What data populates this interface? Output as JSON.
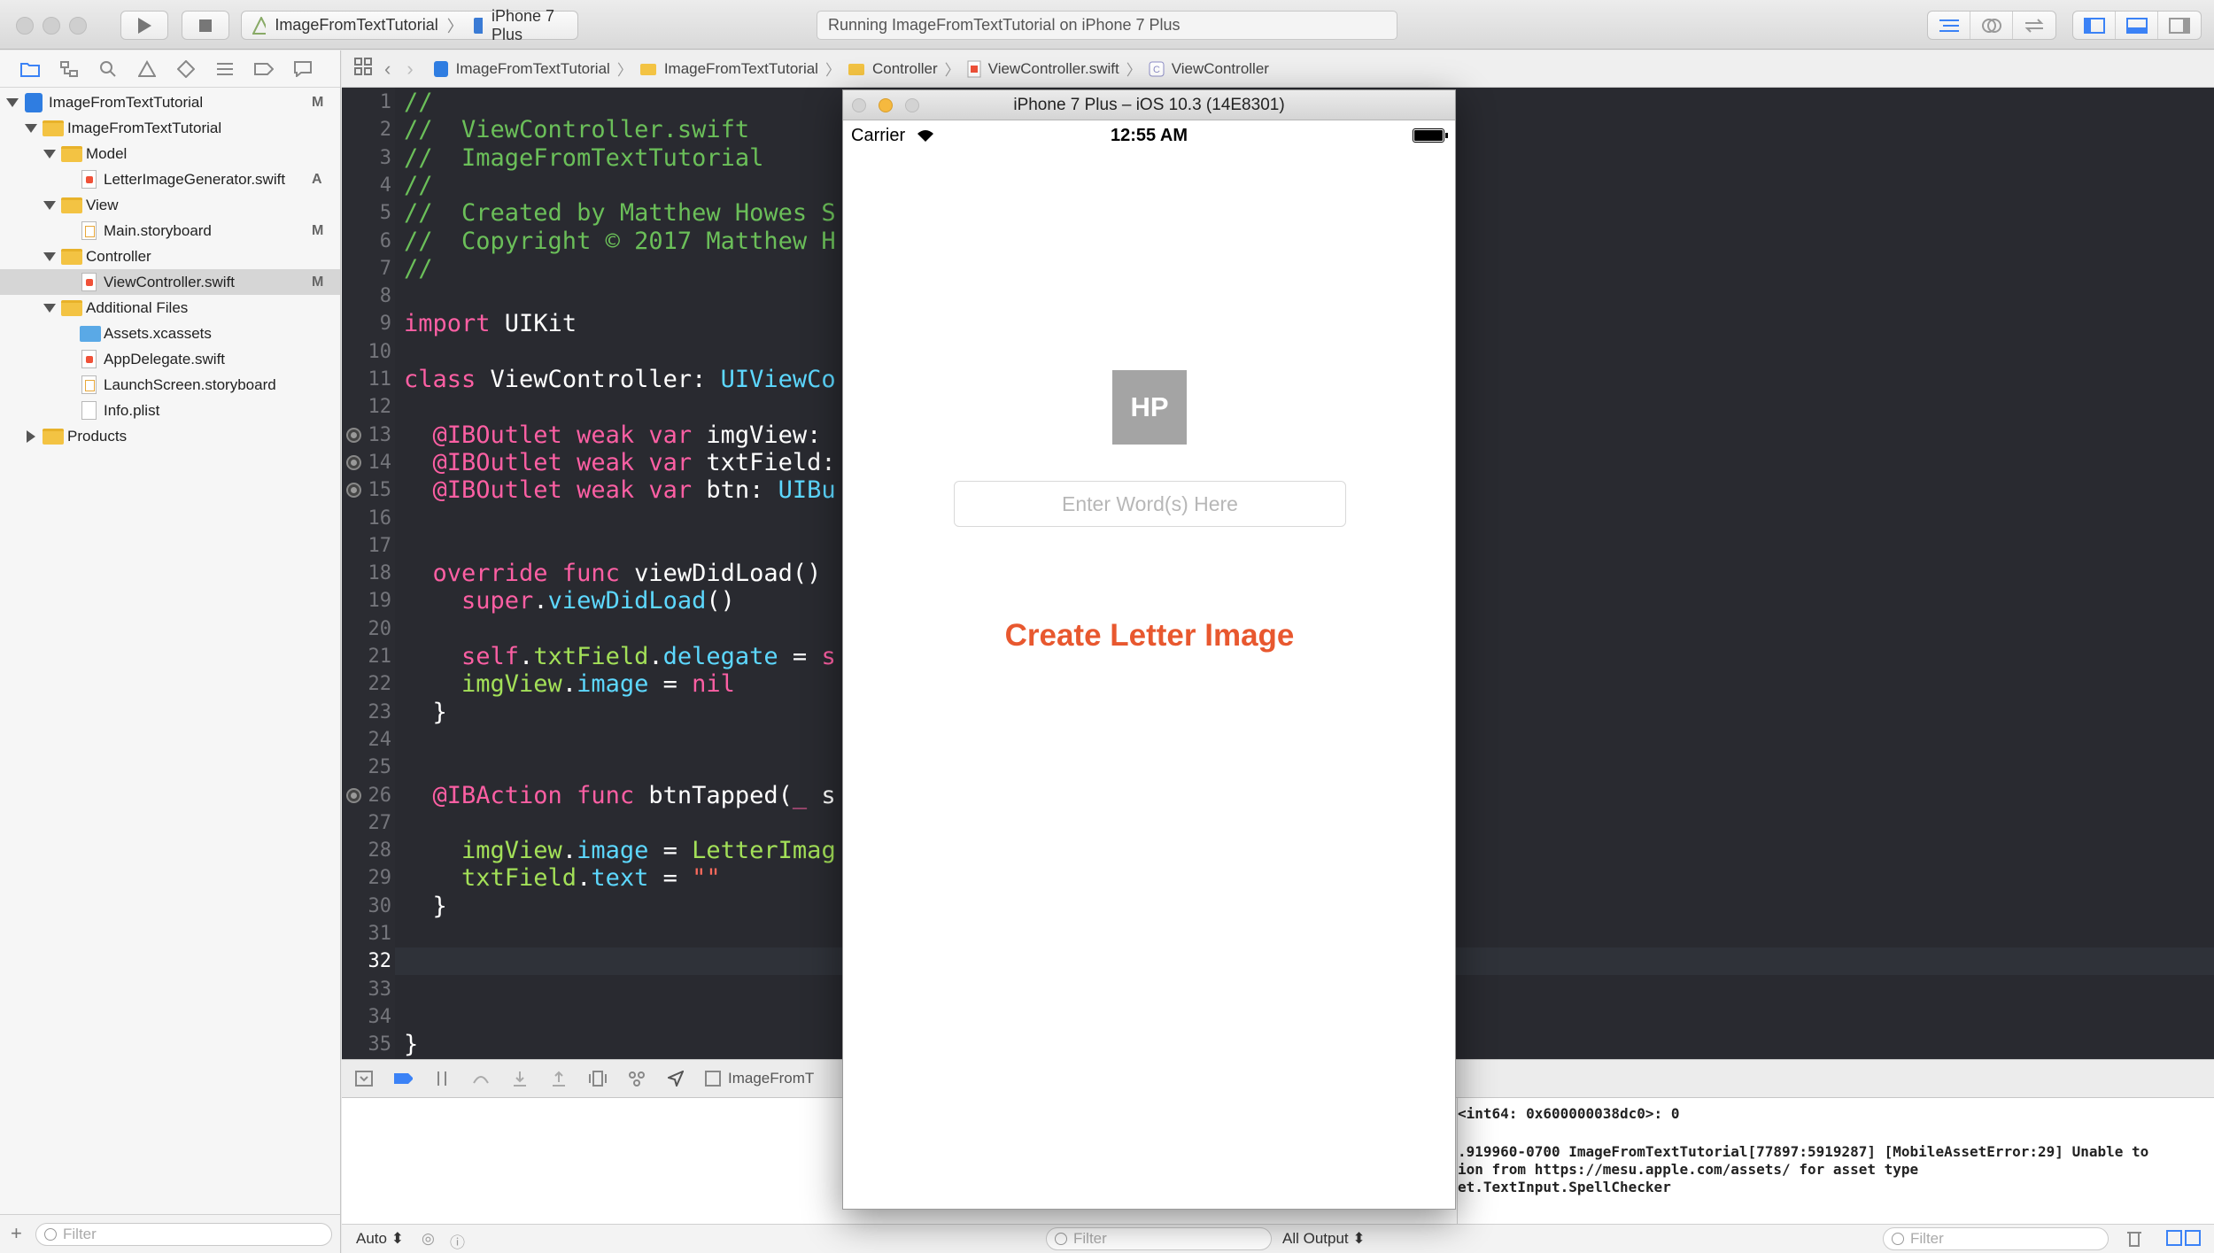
{
  "toolbar": {
    "scheme_project": "ImageFromTextTutorial",
    "scheme_device": "iPhone 7 Plus",
    "activity_status": "Running ImageFromTextTutorial on iPhone 7 Plus"
  },
  "navigator": {
    "tree": [
      {
        "label": "ImageFromTextTutorial",
        "badge": "M"
      },
      {
        "label": "ImageFromTextTutorial",
        "badge": ""
      },
      {
        "label": "Model",
        "badge": ""
      },
      {
        "label": "LetterImageGenerator.swift",
        "badge": "A"
      },
      {
        "label": "View",
        "badge": ""
      },
      {
        "label": "Main.storyboard",
        "badge": "M"
      },
      {
        "label": "Controller",
        "badge": ""
      },
      {
        "label": "ViewController.swift",
        "badge": "M"
      },
      {
        "label": "Additional Files",
        "badge": ""
      },
      {
        "label": "Assets.xcassets",
        "badge": ""
      },
      {
        "label": "AppDelegate.swift",
        "badge": ""
      },
      {
        "label": "LaunchScreen.storyboard",
        "badge": ""
      },
      {
        "label": "Info.plist",
        "badge": ""
      },
      {
        "label": "Products",
        "badge": ""
      }
    ],
    "filter_placeholder": "Filter"
  },
  "jumpbar": {
    "items": [
      "ImageFromTextTutorial",
      "ImageFromTextTutorial",
      "Controller",
      "ViewController.swift",
      "ViewController"
    ]
  },
  "editor": {
    "line_numbers": [
      "1",
      "2",
      "3",
      "4",
      "5",
      "6",
      "7",
      "8",
      "9",
      "10",
      "11",
      "12",
      "13",
      "14",
      "15",
      "16",
      "17",
      "18",
      "19",
      "20",
      "21",
      "22",
      "23",
      "24",
      "25",
      "26",
      "27",
      "28",
      "29",
      "30",
      "31",
      "32",
      "33",
      "34",
      "35"
    ],
    "current_line": "32",
    "lines": [
      {
        "n": 1,
        "parts": [
          {
            "c": "c-comment",
            "t": "//"
          }
        ]
      },
      {
        "n": 2,
        "parts": [
          {
            "c": "c-comment",
            "t": "//  ViewController.swift"
          }
        ]
      },
      {
        "n": 3,
        "parts": [
          {
            "c": "c-comment",
            "t": "//  ImageFromTextTutorial"
          }
        ]
      },
      {
        "n": 4,
        "parts": [
          {
            "c": "c-comment",
            "t": "//"
          }
        ]
      },
      {
        "n": 5,
        "parts": [
          {
            "c": "c-comment",
            "t": "//  Created by Matthew Howes S"
          }
        ]
      },
      {
        "n": 6,
        "parts": [
          {
            "c": "c-comment",
            "t": "//  Copyright © 2017 Matthew H"
          }
        ]
      },
      {
        "n": 7,
        "parts": [
          {
            "c": "c-comment",
            "t": "//"
          }
        ]
      },
      {
        "n": 9,
        "parts": [
          {
            "c": "c-kw",
            "t": "import"
          },
          {
            "c": "",
            "t": " UIKit"
          }
        ]
      },
      {
        "n": 11,
        "parts": [
          {
            "c": "c-kw",
            "t": "class"
          },
          {
            "c": "",
            "t": " ViewController: "
          },
          {
            "c": "c-type",
            "t": "UIViewCo"
          }
        ]
      },
      {
        "n": 13,
        "parts": [
          {
            "c": "c-kw",
            "t": "  @IBOutlet weak var"
          },
          {
            "c": "",
            "t": " imgView:"
          }
        ]
      },
      {
        "n": 14,
        "parts": [
          {
            "c": "c-kw",
            "t": "  @IBOutlet weak var"
          },
          {
            "c": "",
            "t": " txtField:"
          }
        ]
      },
      {
        "n": 15,
        "parts": [
          {
            "c": "c-kw",
            "t": "  @IBOutlet weak var"
          },
          {
            "c": "",
            "t": " btn: "
          },
          {
            "c": "c-type",
            "t": "UIBu"
          }
        ]
      },
      {
        "n": 18,
        "parts": [
          {
            "c": "c-kw",
            "t": "  override func"
          },
          {
            "c": "",
            "t": " viewDidLoad()"
          }
        ]
      },
      {
        "n": 19,
        "parts": [
          {
            "c": "c-kw",
            "t": "    super"
          },
          {
            "c": "",
            "t": "."
          },
          {
            "c": "c-type",
            "t": "viewDidLoad"
          },
          {
            "c": "",
            "t": "()"
          }
        ]
      },
      {
        "n": 21,
        "parts": [
          {
            "c": "c-kw",
            "t": "    self"
          },
          {
            "c": "",
            "t": "."
          },
          {
            "c": "c-prop",
            "t": "txtField"
          },
          {
            "c": "",
            "t": "."
          },
          {
            "c": "c-type",
            "t": "delegate"
          },
          {
            "c": "",
            "t": " = "
          },
          {
            "c": "c-kw",
            "t": "s"
          }
        ]
      },
      {
        "n": 22,
        "parts": [
          {
            "c": "c-prop",
            "t": "    imgView"
          },
          {
            "c": "",
            "t": "."
          },
          {
            "c": "c-type",
            "t": "image"
          },
          {
            "c": "",
            "t": " = "
          },
          {
            "c": "c-kw",
            "t": "nil"
          }
        ]
      },
      {
        "n": 23,
        "parts": [
          {
            "c": "",
            "t": "  }"
          }
        ]
      },
      {
        "n": 26,
        "parts": [
          {
            "c": "c-kw",
            "t": "  @IBAction func"
          },
          {
            "c": "",
            "t": " btnTapped("
          },
          {
            "c": "c-kw",
            "t": "_"
          },
          {
            "c": "",
            "t": " s"
          }
        ]
      },
      {
        "n": 28,
        "parts": [
          {
            "c": "c-prop",
            "t": "    imgView"
          },
          {
            "c": "",
            "t": "."
          },
          {
            "c": "c-type",
            "t": "image"
          },
          {
            "c": "",
            "t": " = "
          },
          {
            "c": "c-prop",
            "t": "LetterImag"
          }
        ]
      },
      {
        "n": 29,
        "parts": [
          {
            "c": "c-prop",
            "t": "    txtField"
          },
          {
            "c": "",
            "t": "."
          },
          {
            "c": "c-type",
            "t": "text"
          },
          {
            "c": "",
            "t": " = "
          },
          {
            "c": "c-str",
            "t": "\"\""
          }
        ]
      },
      {
        "n": 30,
        "parts": [
          {
            "c": "",
            "t": "  }"
          }
        ]
      },
      {
        "n": 35,
        "parts": [
          {
            "c": "",
            "t": "}"
          }
        ]
      }
    ],
    "breakpoint_lines": [
      "13",
      "14",
      "15",
      "26"
    ]
  },
  "debug": {
    "target_label": "ImageFromT",
    "auto_label": "Auto ⬍",
    "all_output_label": "All Output ⬍",
    "filter_placeholder": "Filter"
  },
  "console": {
    "lines": [
      "<int64: 0x600000038dc0>: 0",
      "",
      ".919960-0700 ImageFromTextTutorial[77897:5919287] [MobileAssetError:29] Unable to",
      "ion from https://mesu.apple.com/assets/ for asset type",
      "et.TextInput.SpellChecker"
    ]
  },
  "simulator": {
    "title": "iPhone 7 Plus – iOS 10.3 (14E8301)",
    "carrier": "Carrier",
    "time": "12:55 AM",
    "image_initials": "HP",
    "text_field_placeholder": "Enter Word(s) Here",
    "create_button_label": "Create Letter Image",
    "accent_color": "#e8582f"
  }
}
